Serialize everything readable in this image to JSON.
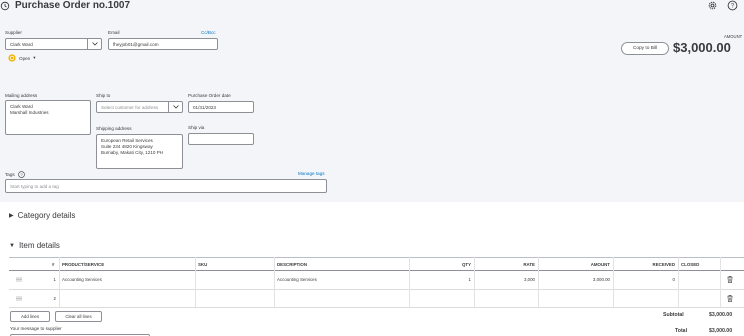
{
  "header": {
    "title": "Purchase Order no.1007",
    "history_icon": "history-icon",
    "settings_icon": "gear-icon",
    "help_icon": "help-icon"
  },
  "supplier": {
    "label": "Supplier",
    "value": "Clark Ward"
  },
  "email": {
    "label": "Email",
    "value": "fheyjob01@gmail.com",
    "cc_bcc": "Cc/Bcc"
  },
  "status": {
    "value": "Open",
    "caret": "▾"
  },
  "amount": {
    "label": "AMOUNT",
    "value": "$3,000.00",
    "copy_to_bill": "Copy to Bill"
  },
  "mailing_address": {
    "label": "Mailing address",
    "lines": [
      "Clark Ward",
      "Marshall Industries"
    ]
  },
  "ship_to": {
    "label": "Ship to",
    "placeholder": "Select customer for address"
  },
  "shipping_address": {
    "label": "Shipping address",
    "lines": [
      "European Retail Services",
      "Suite 234 4820 Kingsway",
      "Burnaby, Makati City, 1210 PH"
    ]
  },
  "po_date": {
    "label": "Purchase Order date",
    "value": "01/31/2023"
  },
  "ship_via": {
    "label": "Ship via",
    "value": ""
  },
  "tags": {
    "label": "Tags",
    "manage": "Manage tags",
    "placeholder": "Start typing to add a tag"
  },
  "category_details": {
    "title": "Category details",
    "toggle": "▶"
  },
  "item_details": {
    "title": "Item details",
    "toggle": "▼",
    "columns": [
      "#",
      "PRODUCT/SERVICE",
      "SKU",
      "DESCRIPTION",
      "QTY",
      "RATE",
      "AMOUNT",
      "RECEIVED",
      "CLOSED"
    ],
    "rows": [
      {
        "num": "1",
        "product": "Accounting Services",
        "sku": "",
        "description": "Accounting Services",
        "qty": "1",
        "rate": "3,000",
        "amount": "3,000.00",
        "received": "0",
        "closed": ""
      },
      {
        "num": "2",
        "product": "",
        "sku": "",
        "description": "",
        "qty": "",
        "rate": "",
        "amount": "",
        "received": "",
        "closed": ""
      }
    ],
    "add_lines": "Add lines",
    "clear_lines": "Clear all lines"
  },
  "message": {
    "label": "Your message to supplier"
  },
  "totals": {
    "subtotal_label": "Subtotal",
    "subtotal_value": "$3,000.00",
    "total_label": "Total",
    "total_value": "$3,000.00"
  },
  "colors": {
    "link": "#0077c5",
    "status_icon": "#f2b100",
    "band_bg": "#f4f5f8"
  }
}
